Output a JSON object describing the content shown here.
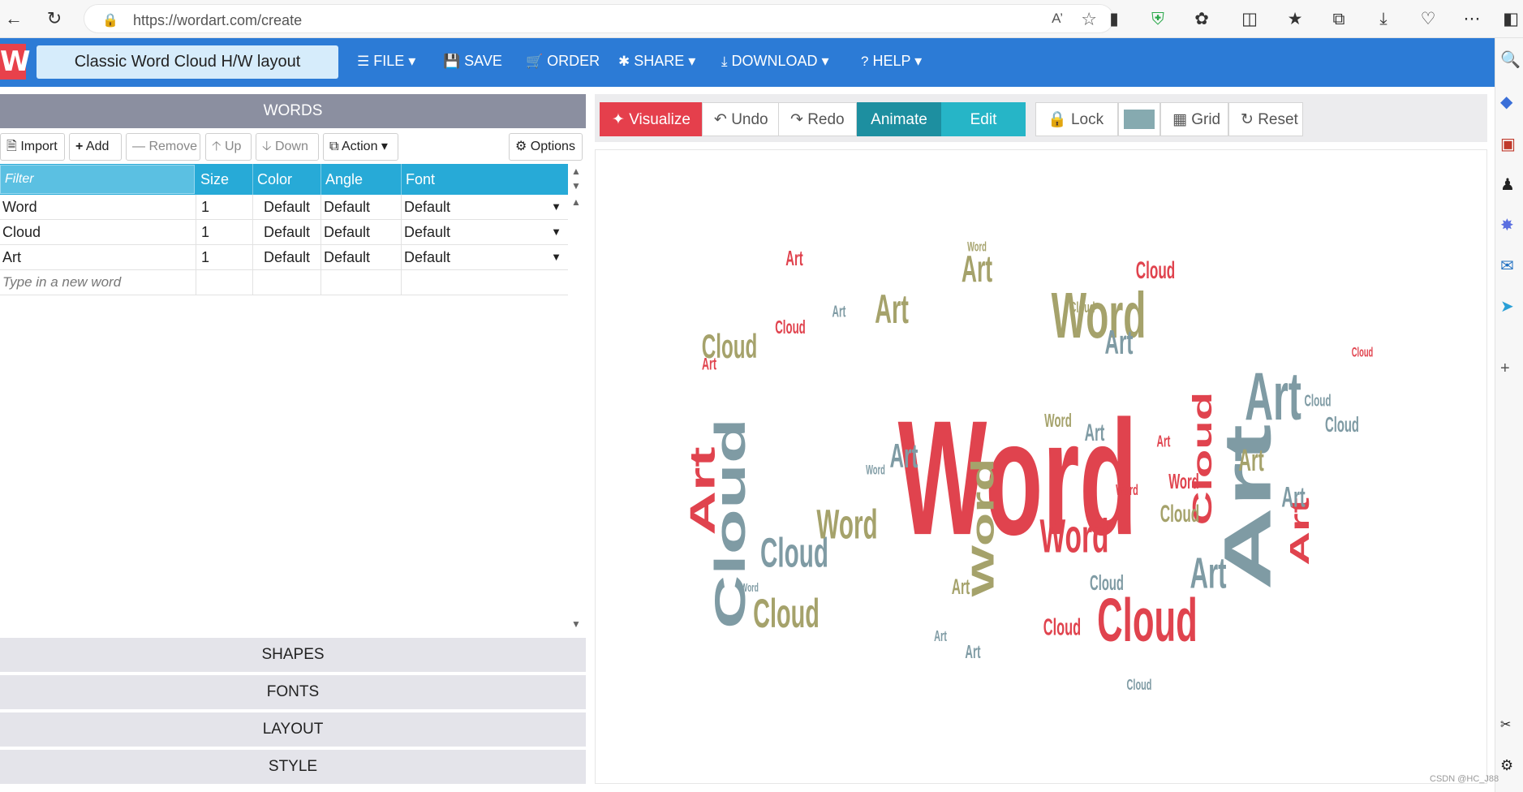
{
  "browser": {
    "url": "https://wordart.com/create",
    "reader_label": "A̅",
    "icons": [
      "back-icon",
      "refresh-icon",
      "lock-icon",
      "read-aloud-icon",
      "favorite-icon",
      "app-icon",
      "shield-icon",
      "extensions-icon",
      "split-screen-icon",
      "favorites-icon",
      "collections-icon",
      "download-icon",
      "performance-icon",
      "more-icon",
      "sidebar-icon"
    ]
  },
  "app": {
    "logo_letter": "W",
    "doc_title": "Classic Word Cloud H/W layout",
    "menu": {
      "file": "FILE",
      "save": "SAVE",
      "order": "ORDER",
      "share": "SHARE",
      "download": "DOWNLOAD",
      "help": "HELP"
    }
  },
  "words_panel": {
    "header": "WORDS",
    "toolbar": {
      "import": "Import",
      "add": "Add",
      "remove": "Remove",
      "up": "Up",
      "down": "Down",
      "action": "Action",
      "options": "Options"
    },
    "columns": {
      "filter": "Filter",
      "size": "Size",
      "color": "Color",
      "angle": "Angle",
      "font": "Font"
    },
    "rows": [
      {
        "word": "Word",
        "size": "1",
        "color": "Default",
        "angle": "Default",
        "font": "Default"
      },
      {
        "word": "Cloud",
        "size": "1",
        "color": "Default",
        "angle": "Default",
        "font": "Default"
      },
      {
        "word": "Art",
        "size": "1",
        "color": "Default",
        "angle": "Default",
        "font": "Default"
      }
    ],
    "new_word_placeholder": "Type in a new word"
  },
  "sections": {
    "shapes": "SHAPES",
    "fonts": "FONTS",
    "layout": "LAYOUT",
    "style": "STYLE"
  },
  "canvas_toolbar": {
    "visualize": "Visualize",
    "undo": "Undo",
    "redo": "Redo",
    "animate": "Animate",
    "edit": "Edit",
    "lock": "Lock",
    "grid": "Grid",
    "reset": "Reset",
    "swatch_color": "#86aab0"
  },
  "colors": {
    "red": "#e0434e",
    "olive": "#a5a26b",
    "slate": "#7f9ba4",
    "appbar": "#2c7bd6",
    "visualize": "#e53f4c",
    "animate": "#1d8fa0",
    "edit": "#26b5c7"
  },
  "cloud_words": [
    {
      "t": "Word",
      "c": "red",
      "size": 240
    },
    {
      "t": "Art",
      "c": "slate",
      "size": 170,
      "rot": -90
    },
    {
      "t": "Cloud",
      "c": "slate",
      "size": 110,
      "rot": -90
    },
    {
      "t": "Art",
      "c": "red",
      "size": 90,
      "rot": -90
    },
    {
      "t": "Word",
      "c": "olive",
      "size": 95
    },
    {
      "t": "Art",
      "c": "slate",
      "size": 100
    },
    {
      "t": "Cloud",
      "c": "red",
      "size": 90
    },
    {
      "t": "Cloud",
      "c": "olive",
      "size": 60
    },
    {
      "t": "Word",
      "c": "red",
      "size": 70
    },
    {
      "t": "Word",
      "c": "olive",
      "size": 80,
      "rot": -90
    },
    {
      "t": "Cloud",
      "c": "red",
      "size": 70,
      "rot": -90
    },
    {
      "t": "Art",
      "c": "red",
      "size": 70,
      "rot": -90
    },
    {
      "t": "Cloud",
      "c": "slate",
      "size": 62
    },
    {
      "t": "Word",
      "c": "olive",
      "size": 62
    },
    {
      "t": "Art",
      "c": "olive",
      "size": 55
    },
    {
      "t": "Art",
      "c": "olive",
      "size": 60
    },
    {
      "t": "Cloud",
      "c": "olive",
      "size": 50
    },
    {
      "t": "Art",
      "c": "slate",
      "size": 50
    },
    {
      "t": "Art",
      "c": "slate",
      "size": 65
    },
    {
      "t": "Art",
      "c": "slate",
      "size": 50
    },
    {
      "t": "Art",
      "c": "olive",
      "size": 45
    },
    {
      "t": "Cloud",
      "c": "slate",
      "size": 30
    },
    {
      "t": "Word",
      "c": "olive",
      "size": 20
    },
    {
      "t": "Cloud",
      "c": "red",
      "size": 35
    },
    {
      "t": "Art",
      "c": "slate",
      "size": 42
    },
    {
      "t": "Cloud",
      "c": "red",
      "size": 28
    },
    {
      "t": "Art",
      "c": "red",
      "size": 26
    },
    {
      "t": "Art",
      "c": "slate",
      "size": 35
    },
    {
      "t": "Cloud",
      "c": "olive",
      "size": 35
    },
    {
      "t": "Word",
      "c": "red",
      "size": 30
    },
    {
      "t": "Art",
      "c": "olive",
      "size": 32
    },
    {
      "t": "Cloud",
      "c": "olive",
      "size": 22
    },
    {
      "t": "Art",
      "c": "slate",
      "size": 28
    },
    {
      "t": "Word",
      "c": "red",
      "size": 22
    },
    {
      "t": "Word",
      "c": "olive",
      "size": 28
    },
    {
      "t": "Cloud",
      "c": "red",
      "size": 34
    },
    {
      "t": "Art",
      "c": "slate",
      "size": 24
    },
    {
      "t": "Word",
      "c": "slate",
      "size": 20
    },
    {
      "t": "Cloud",
      "c": "red",
      "size": 20
    },
    {
      "t": "Art",
      "c": "red",
      "size": 30
    },
    {
      "t": "Cloud",
      "c": "slate",
      "size": 30
    },
    {
      "t": "Cloud",
      "c": "slate",
      "size": 24
    },
    {
      "t": "Art",
      "c": "red",
      "size": 24
    },
    {
      "t": "Word",
      "c": "slate",
      "size": 18
    },
    {
      "t": "Cloud",
      "c": "slate",
      "size": 22
    },
    {
      "t": "Art",
      "c": "slate",
      "size": 22
    }
  ],
  "watermark": "CSDN @HC_J88"
}
